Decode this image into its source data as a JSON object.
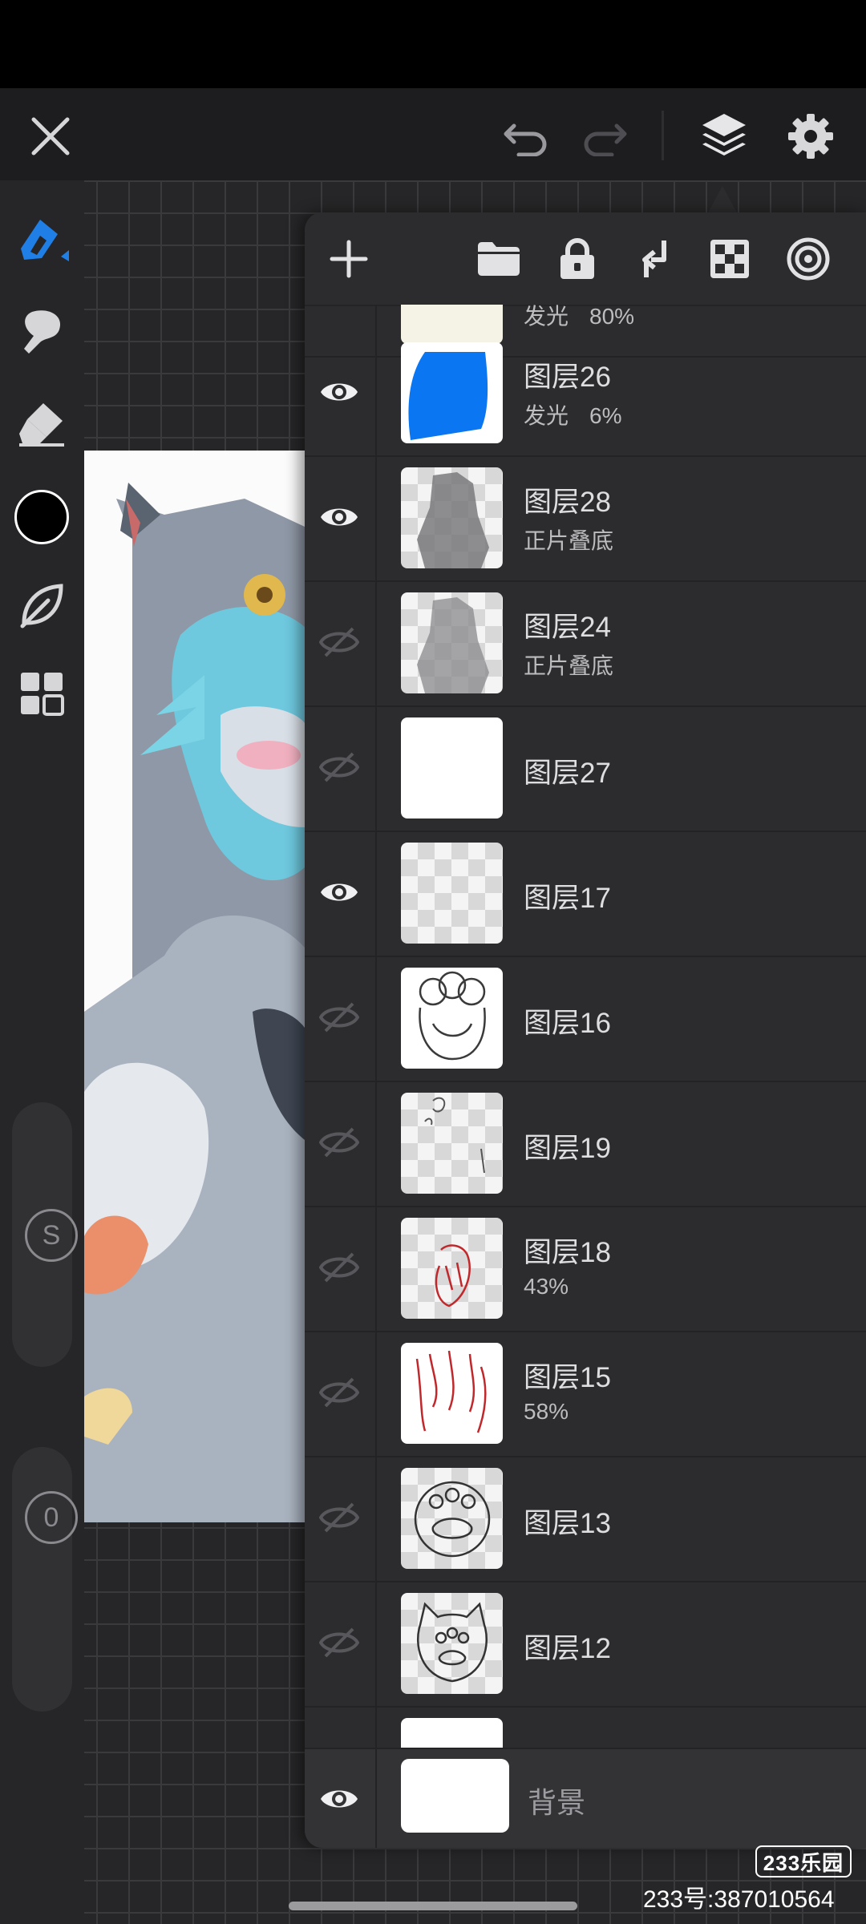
{
  "app": {
    "window_title": "",
    "colors": {
      "accent_blue": "#1f7fe6",
      "panel_bg": "#2c2c2e",
      "toolbar_bg": "#1d1d1f",
      "icon_grey": "#9a9a9e",
      "active_color_swatch": "#000000"
    }
  },
  "topbar": {
    "icons": [
      "close-icon",
      "undo-icon",
      "redo-icon",
      "layers-icon",
      "settings-gear-icon"
    ]
  },
  "left_toolbar": {
    "tools": [
      "brush-icon",
      "smudge-icon",
      "eraser-icon",
      "color-swatch",
      "leaf-brush-icon",
      "grid-menu-icon"
    ],
    "size_slider_label": "S",
    "opacity_slider_label": "0"
  },
  "layers_panel": {
    "toolbar_icons": [
      "add-layer-icon",
      "folder-icon",
      "lock-icon",
      "merge-down-icon",
      "alpha-lock-icon",
      "blend-mode-icon"
    ],
    "partial_top_layer": {
      "sub": "发光",
      "opacity": "80%"
    },
    "layers": [
      {
        "name": "图层26",
        "blend": "发光",
        "opacity": "6%",
        "visible": true,
        "thumb": "blue-shape"
      },
      {
        "name": "图层28",
        "blend": "正片叠底",
        "opacity": "",
        "visible": true,
        "thumb": "grey-figure"
      },
      {
        "name": "图层24",
        "blend": "正片叠底",
        "opacity": "",
        "visible": false,
        "thumb": "grey-figure"
      },
      {
        "name": "图层27",
        "blend": "",
        "opacity": "",
        "visible": false,
        "thumb": "white"
      },
      {
        "name": "图层17",
        "blend": "",
        "opacity": "",
        "visible": true,
        "thumb": "transparent"
      },
      {
        "name": "图层16",
        "blend": "",
        "opacity": "",
        "visible": false,
        "thumb": "paw-sketch"
      },
      {
        "name": "图层19",
        "blend": "",
        "opacity": "",
        "visible": false,
        "thumb": "small-sketch"
      },
      {
        "name": "图层18",
        "blend": "",
        "opacity": "43%",
        "visible": false,
        "thumb": "red-sketch-small"
      },
      {
        "name": "图层15",
        "blend": "",
        "opacity": "58%",
        "visible": false,
        "thumb": "red-sketch"
      },
      {
        "name": "图层13",
        "blend": "",
        "opacity": "",
        "visible": false,
        "thumb": "paw-outline"
      },
      {
        "name": "图层12",
        "blend": "",
        "opacity": "",
        "visible": false,
        "thumb": "cat-paw-sketch"
      }
    ],
    "background_layer": {
      "name": "背景",
      "visible": true
    }
  },
  "watermark": {
    "badge": "233乐园",
    "id_text": "233号:387010564"
  }
}
